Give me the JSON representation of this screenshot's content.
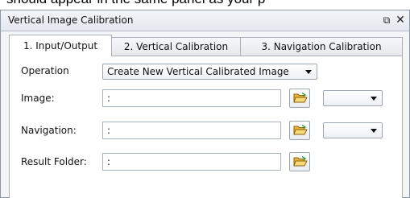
{
  "caption": "should appear in the same panel as your p",
  "window": {
    "title": "Vertical Image Calibration",
    "float_icon": "restore-icon",
    "close_icon": "close-icon",
    "close_glyph": "✕",
    "float_glyph": "⧉"
  },
  "tabs": [
    {
      "label": "1. Input/Output",
      "active": true
    },
    {
      "label": "2. Vertical Calibration",
      "active": false
    },
    {
      "label": "3. Navigation Calibration",
      "active": false
    }
  ],
  "form": {
    "operation": {
      "label": "Operation",
      "value": "Create New Vertical Calibrated Image"
    },
    "image": {
      "label": "Image:",
      "value": ":",
      "option": ""
    },
    "navigation": {
      "label": "Navigation:",
      "value": ":",
      "option": ""
    },
    "result_folder": {
      "label": "Result Folder:",
      "value": ":"
    }
  },
  "icons": {
    "browse": "open-folder-icon"
  }
}
